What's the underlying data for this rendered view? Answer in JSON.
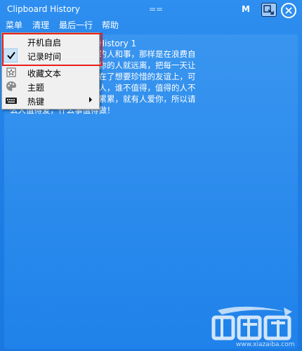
{
  "window": {
    "title": "Clipboard History",
    "center_marker": "==",
    "right_letter": "M",
    "pin_icon": "pin-icon",
    "close_icon": "close-icon"
  },
  "menubar": {
    "items": [
      "菜单",
      "清理",
      "最后一行",
      "帮助"
    ]
  },
  "panel": {
    "title": "History 1",
    "text": "人生，不要去在乎不必要的人和事，那样是在浪费自\n在心里，不张扬，不珍惜你的人就远离，把每一天让\n，以前我也是把时间浪费在了想要珍惜的友谊上，可\n历让我明白了谁是值得的人，谁不值得，值得的人不\n走远，自己不用搞的伤痕累累，就有人爱你，所以请\n么人值得爱，什么事值得做！"
  },
  "context_menu": {
    "items": [
      {
        "label": "开机自启",
        "icon": "none"
      },
      {
        "label": "记录时间",
        "icon": "check-icon",
        "checked": true
      },
      {
        "label": "收藏文本",
        "icon": "star-icon"
      },
      {
        "label": "主题",
        "icon": "palette-icon"
      },
      {
        "label": "热键",
        "icon": "keyboard-icon",
        "submenu": true
      }
    ]
  },
  "annotation": {
    "color": "#e8201c"
  },
  "watermark": {
    "logo_text": "下载吧",
    "site": "www.xiazaiba.com"
  },
  "colors": {
    "background": "#1f7fe6",
    "menu_bg": "#f0f0f0",
    "check_bg": "#cbe4f8"
  }
}
